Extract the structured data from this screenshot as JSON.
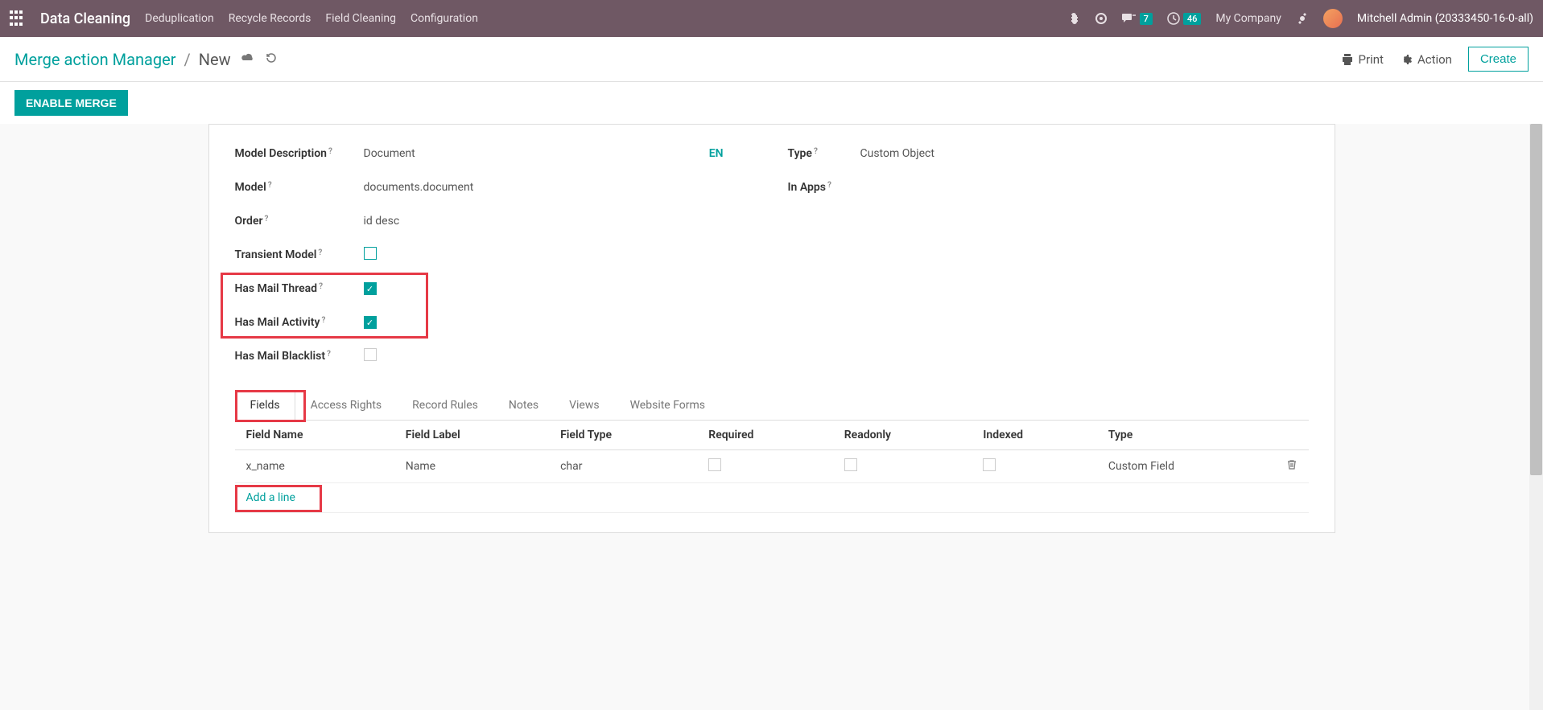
{
  "navbar": {
    "brand": "Data Cleaning",
    "items": [
      "Deduplication",
      "Recycle Records",
      "Field Cleaning",
      "Configuration"
    ],
    "messages_badge": "7",
    "activities_badge": "46",
    "company": "My Company",
    "user": "Mitchell Admin (20333450-16-0-all)"
  },
  "header": {
    "breadcrumb_parent": "Merge action Manager",
    "breadcrumb_current": "New",
    "print": "Print",
    "action": "Action",
    "create": "Create"
  },
  "statusbar": {
    "enable_merge": "ENABLE MERGE"
  },
  "form": {
    "left": {
      "model_description": {
        "label": "Model Description",
        "value": "Document",
        "lang": "EN"
      },
      "model": {
        "label": "Model",
        "value": "documents.document"
      },
      "order": {
        "label": "Order",
        "value": "id desc"
      },
      "transient": {
        "label": "Transient Model",
        "checked": false
      },
      "mail_thread": {
        "label": "Has Mail Thread",
        "checked": true
      },
      "mail_activity": {
        "label": "Has Mail Activity",
        "checked": true
      },
      "mail_blacklist": {
        "label": "Has Mail Blacklist",
        "checked": false
      }
    },
    "right": {
      "type": {
        "label": "Type",
        "value": "Custom Object"
      },
      "in_apps": {
        "label": "In Apps",
        "value": ""
      }
    }
  },
  "tabs": [
    "Fields",
    "Access Rights",
    "Record Rules",
    "Notes",
    "Views",
    "Website Forms"
  ],
  "table": {
    "headers": [
      "Field Name",
      "Field Label",
      "Field Type",
      "Required",
      "Readonly",
      "Indexed",
      "Type"
    ],
    "rows": [
      {
        "field_name": "x_name",
        "field_label": "Name",
        "field_type": "char",
        "required": false,
        "readonly": false,
        "indexed": false,
        "type": "Custom Field"
      }
    ],
    "add_line": "Add a line"
  }
}
